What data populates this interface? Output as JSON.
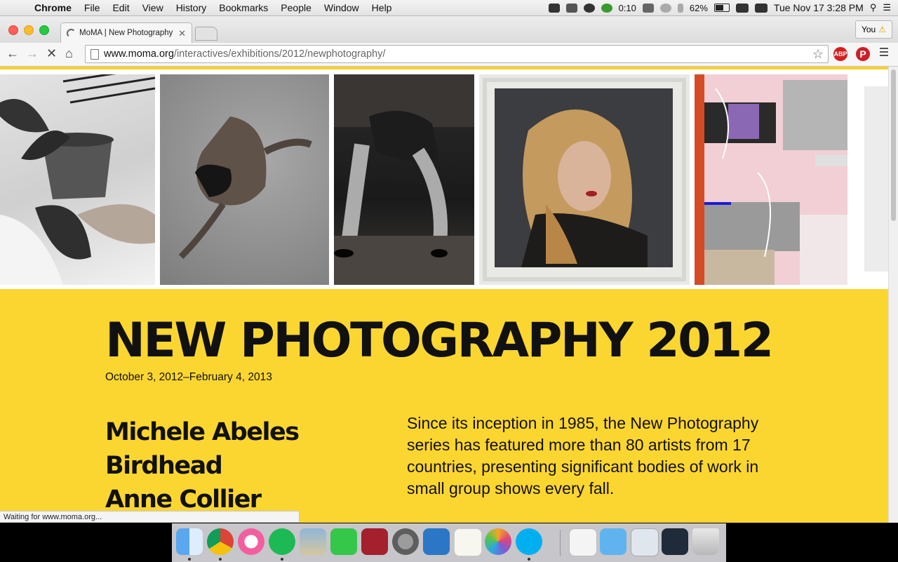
{
  "menubar": {
    "app": "Chrome",
    "items": [
      "File",
      "Edit",
      "View",
      "History",
      "Bookmarks",
      "People",
      "Window",
      "Help"
    ],
    "status": {
      "timer": "0:10",
      "battery": "62%",
      "datetime": "Tue Nov 17  3:28 PM"
    }
  },
  "browser": {
    "tab_title": "MoMA | New Photography",
    "profile_label": "You",
    "url_host": "www.moma.org",
    "url_path": "/interactives/exhibitions/2012/newphotography/",
    "abp_label": "ABP",
    "status_text": "Waiting for www.moma.org..."
  },
  "page": {
    "title": "NEW PHOTOGRAPHY 2012",
    "dates": "October 3, 2012–February 4, 2013",
    "artists": [
      "Michele Abeles",
      "Birdhead",
      "Anne Collier"
    ],
    "description": "Since its inception in 1985, the New Photography series has featured more than 80 artists from 17 countries, presenting significant bodies of work in small group shows every fall.",
    "accent_color": "#fcd630"
  },
  "dock": {
    "apps": [
      "finder-icon",
      "chrome-icon",
      "itunes-icon",
      "spotify-icon",
      "preview-icon",
      "facetime-icon",
      "photo-booth-icon",
      "system-preferences-icon",
      "word-icon",
      "textedit-icon",
      "photos-icon",
      "skype-icon",
      "document-icon",
      "folder-icon",
      "screenshot-icon",
      "screen-recording-icon",
      "trash-icon"
    ]
  }
}
